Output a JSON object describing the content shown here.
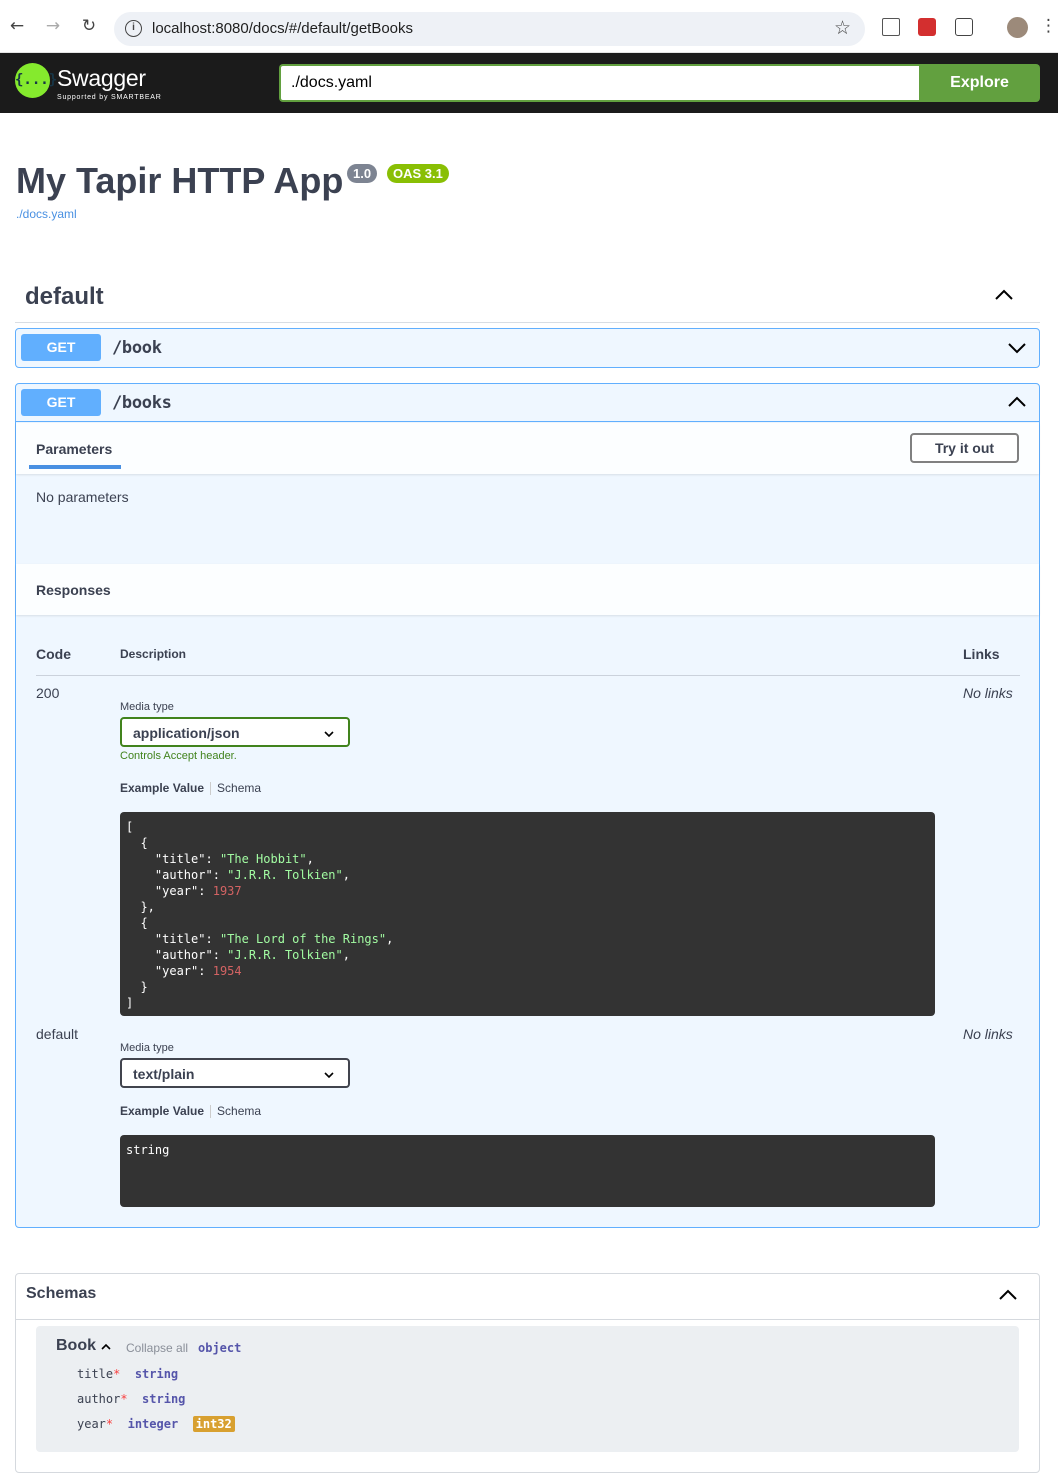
{
  "browser": {
    "url": "localhost:8080/docs/#/default/getBooks"
  },
  "topbar": {
    "logo_text": "Swagger",
    "logo_sub": "Supported by SMARTBEAR",
    "logo_glyph": "{...}",
    "spec_url": "./docs.yaml",
    "explore_label": "Explore"
  },
  "info": {
    "title": "My Tapir HTTP App",
    "version": "1.0",
    "oas": "OAS 3.1",
    "spec_link": "./docs.yaml"
  },
  "tag": {
    "name": "default"
  },
  "operations": [
    {
      "method": "GET",
      "path": "/book"
    },
    {
      "method": "GET",
      "path": "/books"
    }
  ],
  "books_op": {
    "parameters_tab": "Parameters",
    "try_label": "Try it out",
    "no_params": "No parameters",
    "responses_title": "Responses",
    "col_code": "Code",
    "col_description": "Description",
    "col_links": "Links",
    "responses": [
      {
        "code": "200",
        "media_type_label": "Media type",
        "media_type": "application/json",
        "controls_note": "Controls Accept header.",
        "example_tab": "Example Value",
        "schema_tab": "Schema",
        "links": "No links"
      },
      {
        "code": "default",
        "media_type_label": "Media type",
        "media_type": "text/plain",
        "example_tab": "Example Value",
        "schema_tab": "Schema",
        "example": "string",
        "links": "No links"
      }
    ],
    "json_example": [
      {
        "title": "The Hobbit",
        "author": "J.R.R. Tolkien",
        "year": 1937
      },
      {
        "title": "The Lord of the Rings",
        "author": "J.R.R. Tolkien",
        "year": 1954
      }
    ]
  },
  "schemas": {
    "title": "Schemas",
    "model_name": "Book",
    "collapse_all": "Collapse all",
    "model_type": "object",
    "properties": [
      {
        "name": "title",
        "type": "string",
        "format": ""
      },
      {
        "name": "author",
        "type": "string",
        "format": ""
      },
      {
        "name": "year",
        "type": "integer",
        "format": "int32"
      }
    ]
  },
  "colors": {
    "get_blue": "#61affe",
    "explore_green": "#62a03f",
    "topbar_bg": "#1b1b1b",
    "string_green": "#a2fca2",
    "number_red": "#d36363"
  },
  "icons": [
    "back-arrow-icon",
    "forward-arrow-icon",
    "reload-icon",
    "info-icon",
    "star-icon",
    "extension-icon",
    "chevron-up-icon",
    "chevron-down-icon"
  ]
}
